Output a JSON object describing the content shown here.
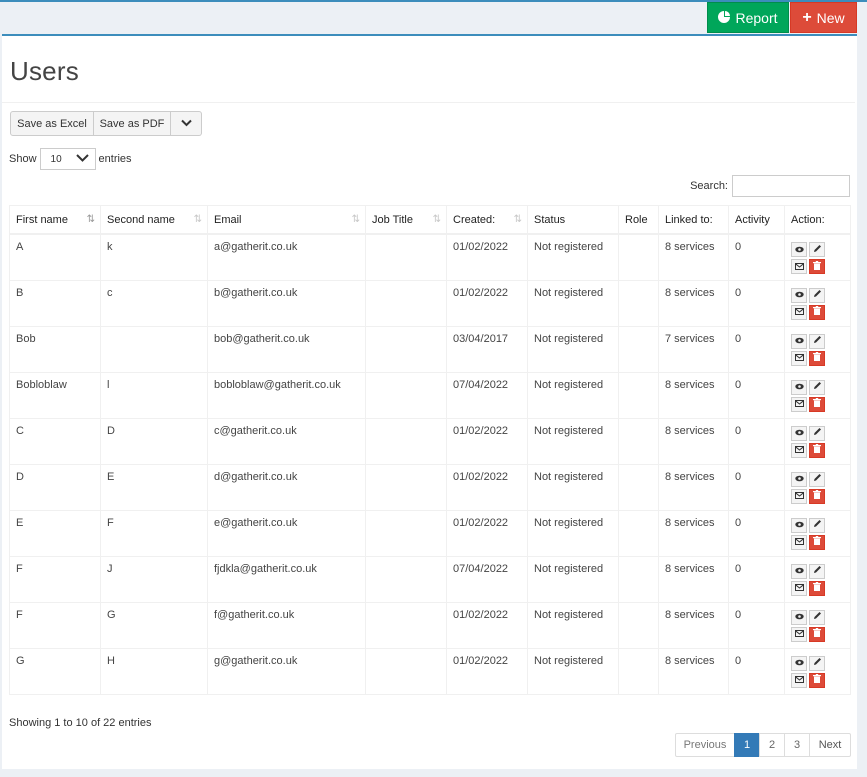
{
  "header": {
    "report_label": "Report",
    "new_label": "New"
  },
  "page": {
    "title": "Users"
  },
  "export": {
    "excel_label": "Save as Excel",
    "pdf_label": "Save as PDF"
  },
  "length": {
    "show_label": "Show",
    "value": "10",
    "entries_label": "entries"
  },
  "search": {
    "label": "Search:",
    "value": ""
  },
  "table": {
    "headers": [
      "First name",
      "Second name",
      "Email",
      "Job Title",
      "Created:",
      "Status",
      "Role",
      "Linked to:",
      "Activity",
      "Action:"
    ],
    "rows": [
      {
        "first": "A",
        "second": "k",
        "email": "a@gatherit.co.uk",
        "job": "",
        "created": "01/02/2022",
        "status": "Not registered",
        "role": "",
        "linked": "8 services",
        "activity": "0"
      },
      {
        "first": "B",
        "second": "c",
        "email": "b@gatherit.co.uk",
        "job": "",
        "created": "01/02/2022",
        "status": "Not registered",
        "role": "",
        "linked": "8 services",
        "activity": "0"
      },
      {
        "first": "Bob",
        "second": "",
        "email": "bob@gatherit.co.uk",
        "job": "",
        "created": "03/04/2017",
        "status": "Not registered",
        "role": "",
        "linked": "7 services",
        "activity": "0"
      },
      {
        "first": "Bobloblaw",
        "second": "l",
        "email": "bobloblaw@gatherit.co.uk",
        "job": "",
        "created": "07/04/2022",
        "status": "Not registered",
        "role": "",
        "linked": "8 services",
        "activity": "0"
      },
      {
        "first": "C",
        "second": "D",
        "email": "c@gatherit.co.uk",
        "job": "",
        "created": "01/02/2022",
        "status": "Not registered",
        "role": "",
        "linked": "8 services",
        "activity": "0"
      },
      {
        "first": "D",
        "second": "E",
        "email": "d@gatherit.co.uk",
        "job": "",
        "created": "01/02/2022",
        "status": "Not registered",
        "role": "",
        "linked": "8 services",
        "activity": "0"
      },
      {
        "first": "E",
        "second": "F",
        "email": "e@gatherit.co.uk",
        "job": "",
        "created": "01/02/2022",
        "status": "Not registered",
        "role": "",
        "linked": "8 services",
        "activity": "0"
      },
      {
        "first": "F",
        "second": "J",
        "email": "fjdkla@gatherit.co.uk",
        "job": "",
        "created": "07/04/2022",
        "status": "Not registered",
        "role": "",
        "linked": "8 services",
        "activity": "0"
      },
      {
        "first": "F",
        "second": "G",
        "email": "f@gatherit.co.uk",
        "job": "",
        "created": "01/02/2022",
        "status": "Not registered",
        "role": "",
        "linked": "8 services",
        "activity": "0"
      },
      {
        "first": "G",
        "second": "H",
        "email": "g@gatherit.co.uk",
        "job": "",
        "created": "01/02/2022",
        "status": "Not registered",
        "role": "",
        "linked": "8 services",
        "activity": "0"
      }
    ],
    "action_icons": [
      "eye-icon",
      "pencil-icon",
      "envelope-icon",
      "trash-icon"
    ]
  },
  "footer": {
    "info": "Showing 1 to 10 of 22 entries",
    "pagination": {
      "previous": "Previous",
      "pages": [
        "1",
        "2",
        "3"
      ],
      "active_page": "1",
      "next": "Next"
    }
  },
  "colors": {
    "accent": "#3c8dbc",
    "report_green": "#00a65a",
    "new_red": "#dd4b39",
    "active_page": "#337ab7"
  }
}
